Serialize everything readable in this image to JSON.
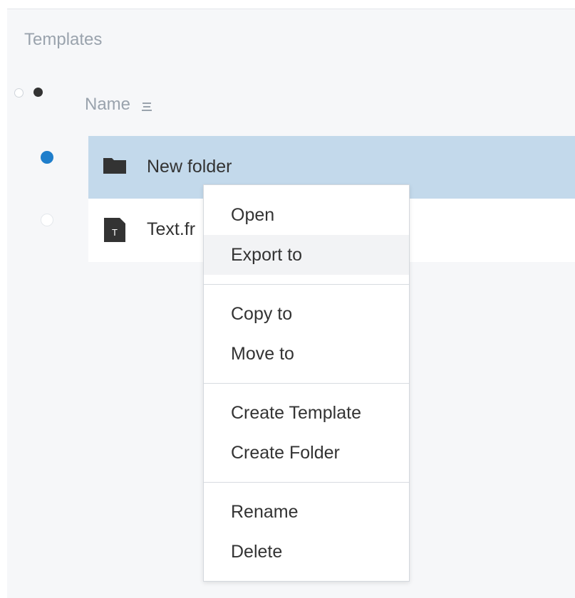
{
  "section_title": "Templates",
  "table_header": {
    "name_label": "Name",
    "sort_icon": "sort-menu-icon"
  },
  "rows": [
    {
      "label": "New folder",
      "type": "folder",
      "icon": "folder-icon",
      "selected": true
    },
    {
      "label": "Text.fr",
      "type": "file",
      "icon": "text-file-icon",
      "icon_letter": "T",
      "selected": false
    }
  ],
  "context_menu": {
    "groups": [
      [
        {
          "label": "Open",
          "highlighted": false
        },
        {
          "label": "Export to",
          "highlighted": true
        }
      ],
      [
        {
          "label": "Copy to",
          "highlighted": false
        },
        {
          "label": "Move to",
          "highlighted": false
        }
      ],
      [
        {
          "label": "Create Template",
          "highlighted": false
        },
        {
          "label": "Create Folder",
          "highlighted": false
        }
      ],
      [
        {
          "label": "Rename",
          "highlighted": false
        },
        {
          "label": "Delete",
          "highlighted": false
        }
      ]
    ]
  },
  "colors": {
    "background": "#f6f7f9",
    "selected_row": "#c3d9eb",
    "selection_dot": "#1f7ecb",
    "muted_text": "#9aa3ad",
    "text": "#333333",
    "menu_hover": "#f2f3f5"
  }
}
